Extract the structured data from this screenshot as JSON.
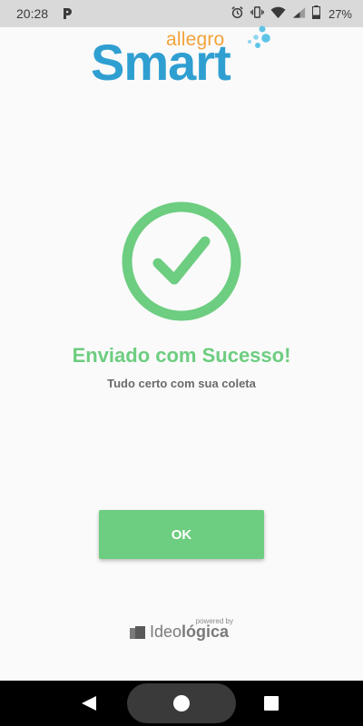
{
  "status_bar": {
    "time": "20:28",
    "battery_percent": "27%",
    "icons": [
      "parking-icon",
      "alarm-icon",
      "vibrate-icon",
      "wifi-icon",
      "signal-icon",
      "battery-icon"
    ]
  },
  "logo": {
    "brand_top": "allegro",
    "brand_main": "Smart"
  },
  "result": {
    "icon": "check-circle-icon",
    "title": "Enviado com Sucesso!",
    "subtitle": "Tudo certo com sua coleta"
  },
  "actions": {
    "ok_label": "OK"
  },
  "footer": {
    "powered_by": "powered by",
    "company_regular": "Ideo",
    "company_bold": "lógica"
  },
  "colors": {
    "success": "#6dcd80",
    "brand_blue": "#2f9fd1",
    "brand_orange": "#f2a33a"
  },
  "nav_bar": {
    "icons": [
      "back-icon",
      "home-icon",
      "recents-icon"
    ]
  }
}
